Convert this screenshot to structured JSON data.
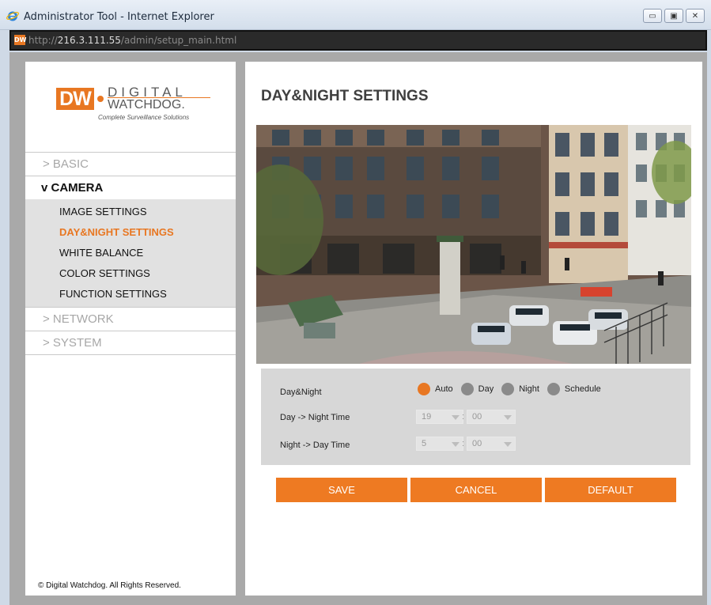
{
  "window": {
    "title": "Administrator Tool - Internet Explorer",
    "minimize": "▭",
    "maximize": "▣",
    "close": "✕"
  },
  "address": {
    "prefix": "http://",
    "host": "216.3.111.55",
    "path": "/admin/setup_main.html",
    "favicon": "DW"
  },
  "logo": {
    "mark": "DW",
    "line1": "DIGITAL",
    "line2": "WATCHDOG.",
    "tagline": "Complete Surveillance Solutions"
  },
  "nav": {
    "basic": "> BASIC",
    "camera": "v CAMERA",
    "camera_items": [
      "IMAGE SETTINGS",
      "DAY&NIGHT SETTINGS",
      "WHITE BALANCE",
      "COLOR SETTINGS",
      "FUNCTION SETTINGS"
    ],
    "network": "> NETWORK",
    "system": "> SYSTEM"
  },
  "footer": {
    "copyright": "© Digital Watchdog. All Rights Reserved."
  },
  "main": {
    "title": "DAY&NIGHT SETTINGS"
  },
  "settings": {
    "daynight_label": "Day&Night",
    "options": [
      "Auto",
      "Day",
      "Night",
      "Schedule"
    ],
    "selected": "Auto",
    "day_to_night_label": "Day -> Night Time",
    "day_to_night_hour": "19",
    "day_to_night_min": "00",
    "night_to_day_label": "Night -> Day Time",
    "night_to_day_hour": "5",
    "night_to_day_min": "00",
    "colon": ":"
  },
  "buttons": {
    "save": "SAVE",
    "cancel": "CANCEL",
    "default": "DEFAULT"
  },
  "colors": {
    "accent": "#E87722",
    "panel": "#D7D7D7",
    "frame": "#A9A9A9"
  }
}
